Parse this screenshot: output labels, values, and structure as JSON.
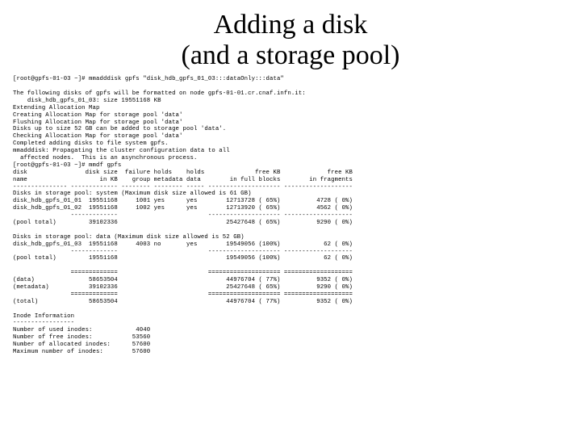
{
  "title_line1": "Adding a disk",
  "title_line2": "(and a storage pool)",
  "term": "[root@gpfs-01-03 ~]# mmadddisk gpfs \"disk_hdb_gpfs_01_03:::dataOnly:::data\"\n\nThe following disks of gpfs will be formatted on node gpfs-01-01.cr.cnaf.infn.it:\n    disk_hdb_gpfs_01_03: size 19551168 KB\nExtending Allocation Map\nCreating Allocation Map for storage pool 'data'\nFlushing Allocation Map for storage pool 'data'\nDisks up to size 52 GB can be added to storage pool 'data'.\nChecking Allocation Map for storage pool 'data'\nCompleted adding disks to file system gpfs.\nmmadddisk: Propagating the cluster configuration data to all\n  affected nodes.  This is an asynchronous process.\n[root@gpfs-01-03 ~]# mmdf gpfs\ndisk                disk size  failure holds    holds              free KB             free KB\nname                    in KB    group metadata data        in full blocks        in fragments\n--------------- ------------- -------- -------- ----- -------------------- -------------------\nDisks in storage pool: system (Maximum disk size allowed is 61 GB)\ndisk_hdb_gpfs_01_01  19551168     1001 yes      yes        12713728 ( 65%)          4728 ( 0%)\ndisk_hdb_gpfs_01_02  19551168     1002 yes      yes        12713920 ( 65%)          4562 ( 0%)\n                -------------                         -------------------- -------------------\n(pool total)         39102336                              25427648 ( 65%)          9290 ( 0%)\n\nDisks in storage pool: data (Maximum disk size allowed is 52 GB)\ndisk_hdb_gpfs_01_03  19551168     4003 no       yes        19549056 (100%)            62 ( 0%)\n                -------------                         -------------------- -------------------\n(pool total)         19551168                              19549056 (100%)            62 ( 0%)\n\n                =============                         ==================== ===================\n(data)               58653504                              44976704 ( 77%)          9352 ( 0%)\n(metadata)           39102336                              25427648 ( 65%)          9290 ( 0%)\n                =============                         ==================== ===================\n(total)              58653504                              44976704 ( 77%)          9352 ( 0%)\n\nInode Information\n-----------------\nNumber of used inodes:            4040\nNumber of free inodes:           53560\nNumber of allocated inodes:      57600\nMaximum number of inodes:        57600"
}
